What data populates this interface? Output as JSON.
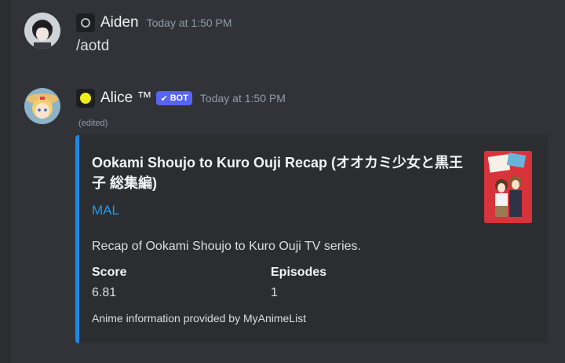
{
  "messages": [
    {
      "author": "Aiden",
      "timestamp": "Today at 1:50 PM",
      "content": "/aotd"
    },
    {
      "author": "Alice ™",
      "bot_tag": "BOT",
      "timestamp": "Today at 1:50 PM",
      "edited": "(edited)"
    }
  ],
  "embed": {
    "title": "Ookami Shoujo to Kuro Ouji Recap (オオカミ少女と黒王子 総集編)",
    "link_text": "MAL",
    "description": "Recap of Ookami Shoujo to Kuro Ouji TV series.",
    "fields": [
      {
        "name": "Score",
        "value": "6.81"
      },
      {
        "name": "Episodes",
        "value": "1"
      }
    ],
    "footer": "Anime information provided by MyAnimeList",
    "accent_color": "#1e88e5"
  },
  "colors": {
    "background": "#313338",
    "embed_background": "#2b2d31",
    "bot_tag": "#5865f2",
    "link": "#1e9bf0"
  },
  "icons": {
    "aiden_status": "status-ring-icon",
    "alice_status": "status-dot-icon",
    "bot_check": "checkmark-icon"
  }
}
